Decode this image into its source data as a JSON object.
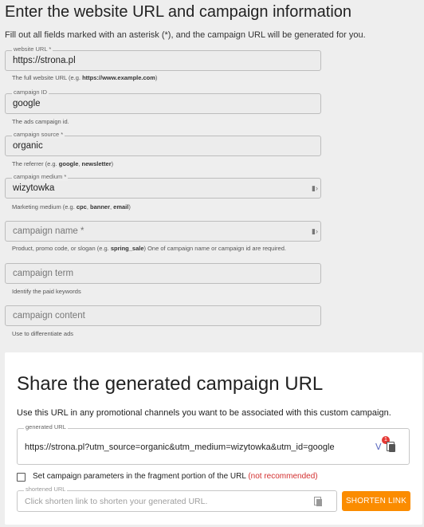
{
  "header": {
    "title": "Enter the website URL and campaign information",
    "intro": "Fill out all fields marked with an asterisk (*), and the campaign URL will be generated for you."
  },
  "fields": {
    "website_url": {
      "label": "website URL *",
      "value": "https://strona.pl",
      "hint_pre": "The full website URL (e.g. ",
      "hint_bold": "https://www.example.com",
      "hint_post": ")"
    },
    "campaign_id": {
      "label": "campaign ID",
      "value": "google",
      "hint": "The ads campaign id."
    },
    "campaign_source": {
      "label": "campaign source *",
      "value": "organic",
      "hint_pre": "The referrer (e.g. ",
      "hint_bold1": "google",
      "hint_sep": ", ",
      "hint_bold2": "newsletter",
      "hint_post": ")"
    },
    "campaign_medium": {
      "label": "campaign medium *",
      "value": "wizytowka",
      "hint_pre": "Marketing medium (e.g. ",
      "hint_bold1": "cpc",
      "hint_sep1": ", ",
      "hint_bold2": "banner",
      "hint_sep2": ", ",
      "hint_bold3": "email",
      "hint_post": ")"
    },
    "campaign_name": {
      "placeholder": "campaign name *",
      "hint_pre": "Product, promo code, or slogan (e.g. ",
      "hint_bold": "spring_sale",
      "hint_post": ") One of campaign name or campaign id are required."
    },
    "campaign_term": {
      "placeholder": "campaign term",
      "hint": "Identify the paid keywords"
    },
    "campaign_content": {
      "placeholder": "campaign content",
      "hint": "Use to differentiate ads"
    }
  },
  "share": {
    "title": "Share the generated campaign URL",
    "description": "Use this URL in any promotional channels you want to be associated with this custom campaign.",
    "generated_label": "generated URL",
    "generated_value": "https://strona.pl?utm_source=organic&utm_medium=wizytowka&utm_id=google",
    "badge_count": "1",
    "fragment_label": "Set campaign parameters in the fragment portion of the URL",
    "fragment_warning": "(not recommended)",
    "shortened_label": "shortened URL",
    "shortened_placeholder": "Click shorten link to shorten your generated URL.",
    "shorten_button": "SHORTEN LINK"
  },
  "colors": {
    "accent_button": "#fb8c00",
    "warning_text": "#d32f2f",
    "badge": "#e53935"
  },
  "icons": [
    "field-action-icon",
    "chevron-icon",
    "copy-icon"
  ]
}
